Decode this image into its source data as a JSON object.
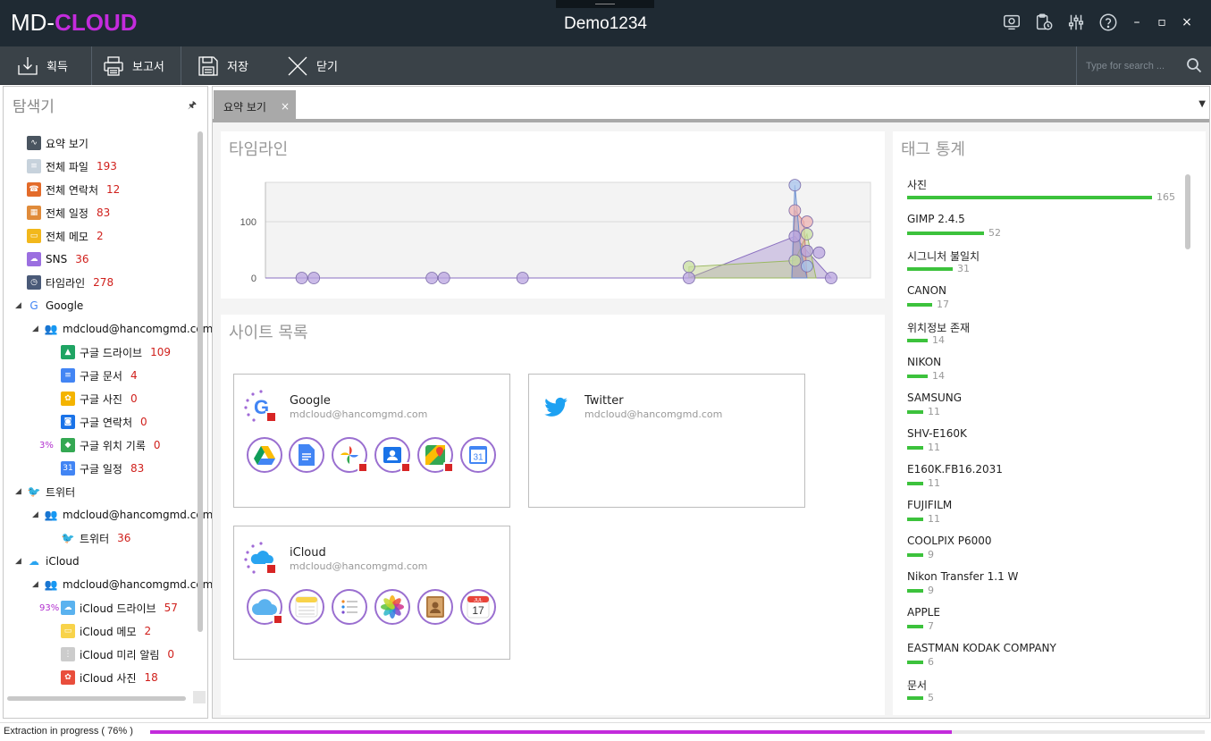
{
  "app": {
    "logo_main": "MD-",
    "logo_accent": "CLOUD",
    "window_title": "Demo1234",
    "accent_color": "#c32bdc"
  },
  "title_icons": [
    "screenshot-icon",
    "clipboard-clock-icon",
    "sliders-icon",
    "help-icon"
  ],
  "window_buttons": {
    "minimize": "–",
    "maximize": "▫",
    "close": "×"
  },
  "toolbar": {
    "acquire_label": "획득",
    "report_label": "보고서",
    "save_label": "저장",
    "close_label": "닫기",
    "search_placeholder": "Type for search ..."
  },
  "explorer": {
    "title": "탐색기",
    "pin": "🖈",
    "items": [
      {
        "label": "요약 보기",
        "count": "",
        "icon": "pulse-icon"
      },
      {
        "label": "전체 파일",
        "count": "193",
        "icon": "file-icon"
      },
      {
        "label": "전체 연락처",
        "count": "12",
        "icon": "phone-icon"
      },
      {
        "label": "전체 일정",
        "count": "83",
        "icon": "calendar-icon"
      },
      {
        "label": "전체  메모",
        "count": "2",
        "icon": "memo-icon"
      },
      {
        "label": "SNS",
        "count": "36",
        "icon": "cloud-icon"
      },
      {
        "label": "타임라인",
        "count": "278",
        "icon": "clock-icon"
      },
      {
        "label": "Google",
        "count": "",
        "icon": "google-icon"
      },
      {
        "label": "mdcloud@hancomgmd.com",
        "count": "",
        "icon": "users-icon"
      },
      {
        "label": "구글 드라이브",
        "count": "109",
        "icon": "google-drive-icon"
      },
      {
        "label": "구글 문서",
        "count": "4",
        "icon": "google-docs-icon"
      },
      {
        "label": "구글 사진",
        "count": "0",
        "icon": "google-photos-icon"
      },
      {
        "label": "구글 연락처",
        "count": "0",
        "icon": "google-contacts-icon"
      },
      {
        "label": "구글 위치 기록",
        "count": "0",
        "icon": "google-maps-icon",
        "prefix": "3%"
      },
      {
        "label": "구글 일정",
        "count": "83",
        "icon": "google-calendar-icon"
      },
      {
        "label": "트위터",
        "count": "",
        "icon": "twitter-icon"
      },
      {
        "label": "mdcloud@hancomgmd.com",
        "count": "",
        "icon": "users-icon"
      },
      {
        "label": "트위터",
        "count": "36",
        "icon": "twitter-icon"
      },
      {
        "label": "iCloud",
        "count": "",
        "icon": "icloud-icon"
      },
      {
        "label": "mdcloud@hancomgmd.com",
        "count": "",
        "icon": "users-icon"
      },
      {
        "label": "iCloud 드라이브",
        "count": "57",
        "icon": "icloud-drive-icon",
        "prefix": "93%"
      },
      {
        "label": "iCloud 메모",
        "count": "2",
        "icon": "icloud-notes-icon"
      },
      {
        "label": "iCloud 미리 알림",
        "count": "0",
        "icon": "icloud-reminders-icon"
      },
      {
        "label": "iCloud 사진",
        "count": "18",
        "icon": "icloud-photos-icon"
      }
    ]
  },
  "tabs": {
    "summary_label": "요약 보기",
    "close": "×",
    "dropdown": "▼"
  },
  "timeline": {
    "title": "타임라인",
    "chart_data": {
      "type": "area",
      "y_ticks": [
        "0",
        "100"
      ],
      "ylim": [
        0,
        170
      ],
      "grid": true
    }
  },
  "sites": {
    "title": "사이트 목록",
    "google": {
      "name": "Google",
      "email": "mdcloud@hancomgmd.com"
    },
    "twitter": {
      "name": "Twitter",
      "email": "mdcloud@hancomgmd.com"
    },
    "icloud": {
      "name": "iCloud",
      "email": "mdcloud@hancomgmd.com"
    },
    "calendar_day": "31",
    "icloud_calendar_month": "JUL",
    "icloud_calendar_day": "17"
  },
  "tag_stats": {
    "title": "태그 통계",
    "bar_color": "#3cc23c",
    "tags": [
      {
        "name": "사진",
        "value": 165
      },
      {
        "name": "GIMP 2.4.5",
        "value": 52
      },
      {
        "name": "시그니처 불일치",
        "value": 31
      },
      {
        "name": "CANON",
        "value": 17
      },
      {
        "name": "위치정보 존재",
        "value": 14
      },
      {
        "name": "NIKON",
        "value": 14
      },
      {
        "name": "SAMSUNG",
        "value": 11
      },
      {
        "name": "SHV-E160K",
        "value": 11
      },
      {
        "name": "E160K.FB16.2031",
        "value": 11
      },
      {
        "name": "FUJIFILM",
        "value": 11
      },
      {
        "name": "COOLPIX P6000",
        "value": 9
      },
      {
        "name": "Nikon Transfer 1.1 W",
        "value": 9
      },
      {
        "name": "APPLE",
        "value": 7
      },
      {
        "name": "EASTMAN KODAK COMPANY",
        "value": 6
      },
      {
        "name": "문서",
        "value": 5
      }
    ]
  },
  "status": {
    "text": "Extraction in progress  ( 76% )",
    "progress_fraction": 0.76
  }
}
